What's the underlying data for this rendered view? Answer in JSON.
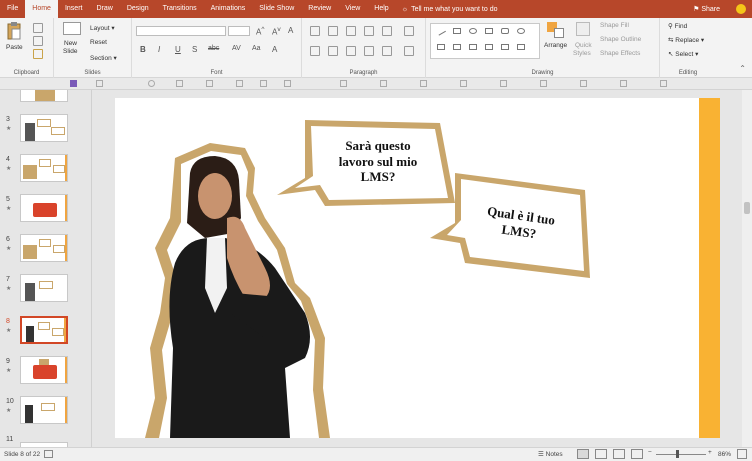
{
  "tabs": [
    "File",
    "Home",
    "Insert",
    "Draw",
    "Design",
    "Transitions",
    "Animations",
    "Slide Show",
    "Review",
    "View",
    "Help"
  ],
  "active_tab": "Home",
  "tell_me": "Tell me what you want to do",
  "share_label": "Share",
  "ribbon": {
    "clipboard": {
      "label": "Clipboard",
      "paste": "Paste"
    },
    "slides": {
      "label": "Slides",
      "new_slide_1": "New",
      "new_slide_2": "Slide",
      "layout": "Layout",
      "reset": "Reset",
      "section": "Section"
    },
    "font": {
      "label": "Font",
      "bold": "B",
      "italic": "I",
      "underline": "U",
      "strike": "S",
      "shadow": "abc",
      "spacing": "AV",
      "case": "Aa"
    },
    "paragraph": {
      "label": "Paragraph"
    },
    "drawing": {
      "label": "Drawing",
      "arrange": "Arrange",
      "quick_styles_1": "Quick",
      "quick_styles_2": "Styles",
      "shape_fill": "Shape Fill",
      "shape_outline": "Shape Outline",
      "shape_effects": "Shape Effects"
    },
    "editing": {
      "label": "Editing",
      "find": "Find",
      "replace": "Replace",
      "select": "Select"
    }
  },
  "thumbnails": [
    "3",
    "4",
    "5",
    "6",
    "7",
    "8",
    "9",
    "10",
    "11"
  ],
  "selected_slide": "8",
  "slide": {
    "bubble1_line1": "Sarà questo",
    "bubble1_line2": "lavoro sul mio",
    "bubble1_line3": "LMS?",
    "bubble2_line1": "Qual è il tuo",
    "bubble2_line2": "LMS?"
  },
  "status": {
    "slide_info": "Slide 8 of 22",
    "notes": "Notes",
    "zoom": "86%"
  },
  "colors": {
    "accent": "#b7472a",
    "stripe": "#f9b233",
    "cork": "#c9a66b"
  }
}
